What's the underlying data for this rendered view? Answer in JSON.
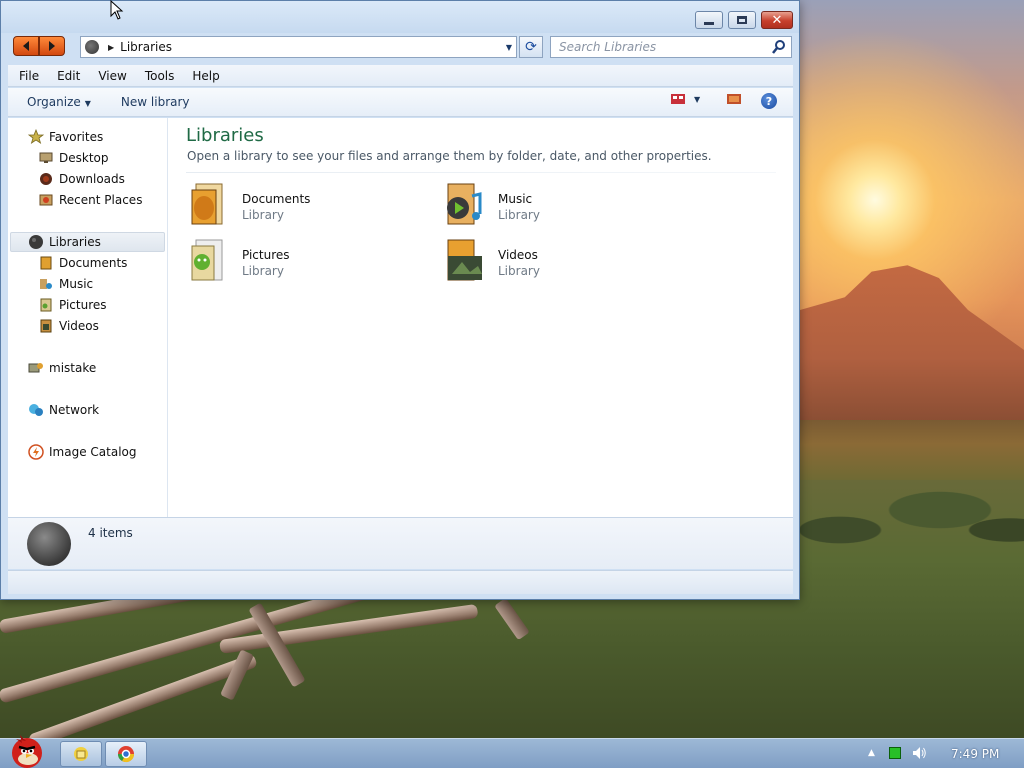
{
  "window": {
    "title_controls": {
      "minimize": "minimize",
      "maximize": "maximize",
      "close": "close"
    }
  },
  "address": {
    "path": "Libraries"
  },
  "search": {
    "placeholder": "Search Libraries"
  },
  "menu": {
    "items": [
      "File",
      "Edit",
      "View",
      "Tools",
      "Help"
    ]
  },
  "toolbar": {
    "organize_label": "Organize",
    "new_library_label": "New library"
  },
  "nav": {
    "favorites": {
      "label": "Favorites",
      "items": [
        "Desktop",
        "Downloads",
        "Recent Places"
      ]
    },
    "libraries": {
      "label": "Libraries",
      "items": [
        "Documents",
        "Music",
        "Pictures",
        "Videos"
      ]
    },
    "homegroup": {
      "label": "mistake"
    },
    "network": {
      "label": "Network"
    },
    "catalog": {
      "label": "Image Catalog"
    }
  },
  "content": {
    "title": "Libraries",
    "description": "Open a library to see your files and arrange them by folder, date, and other properties.",
    "libraries": [
      {
        "name": "Documents",
        "type": "Library"
      },
      {
        "name": "Music",
        "type": "Library"
      },
      {
        "name": "Pictures",
        "type": "Library"
      },
      {
        "name": "Videos",
        "type": "Library"
      }
    ]
  },
  "details": {
    "count_text": "4 items"
  },
  "taskbar": {
    "clock": "7:49 PM"
  },
  "colors": {
    "accent_title": "#1f6a45",
    "nav_button": "#e8601a",
    "close_button": "#c7402c"
  }
}
